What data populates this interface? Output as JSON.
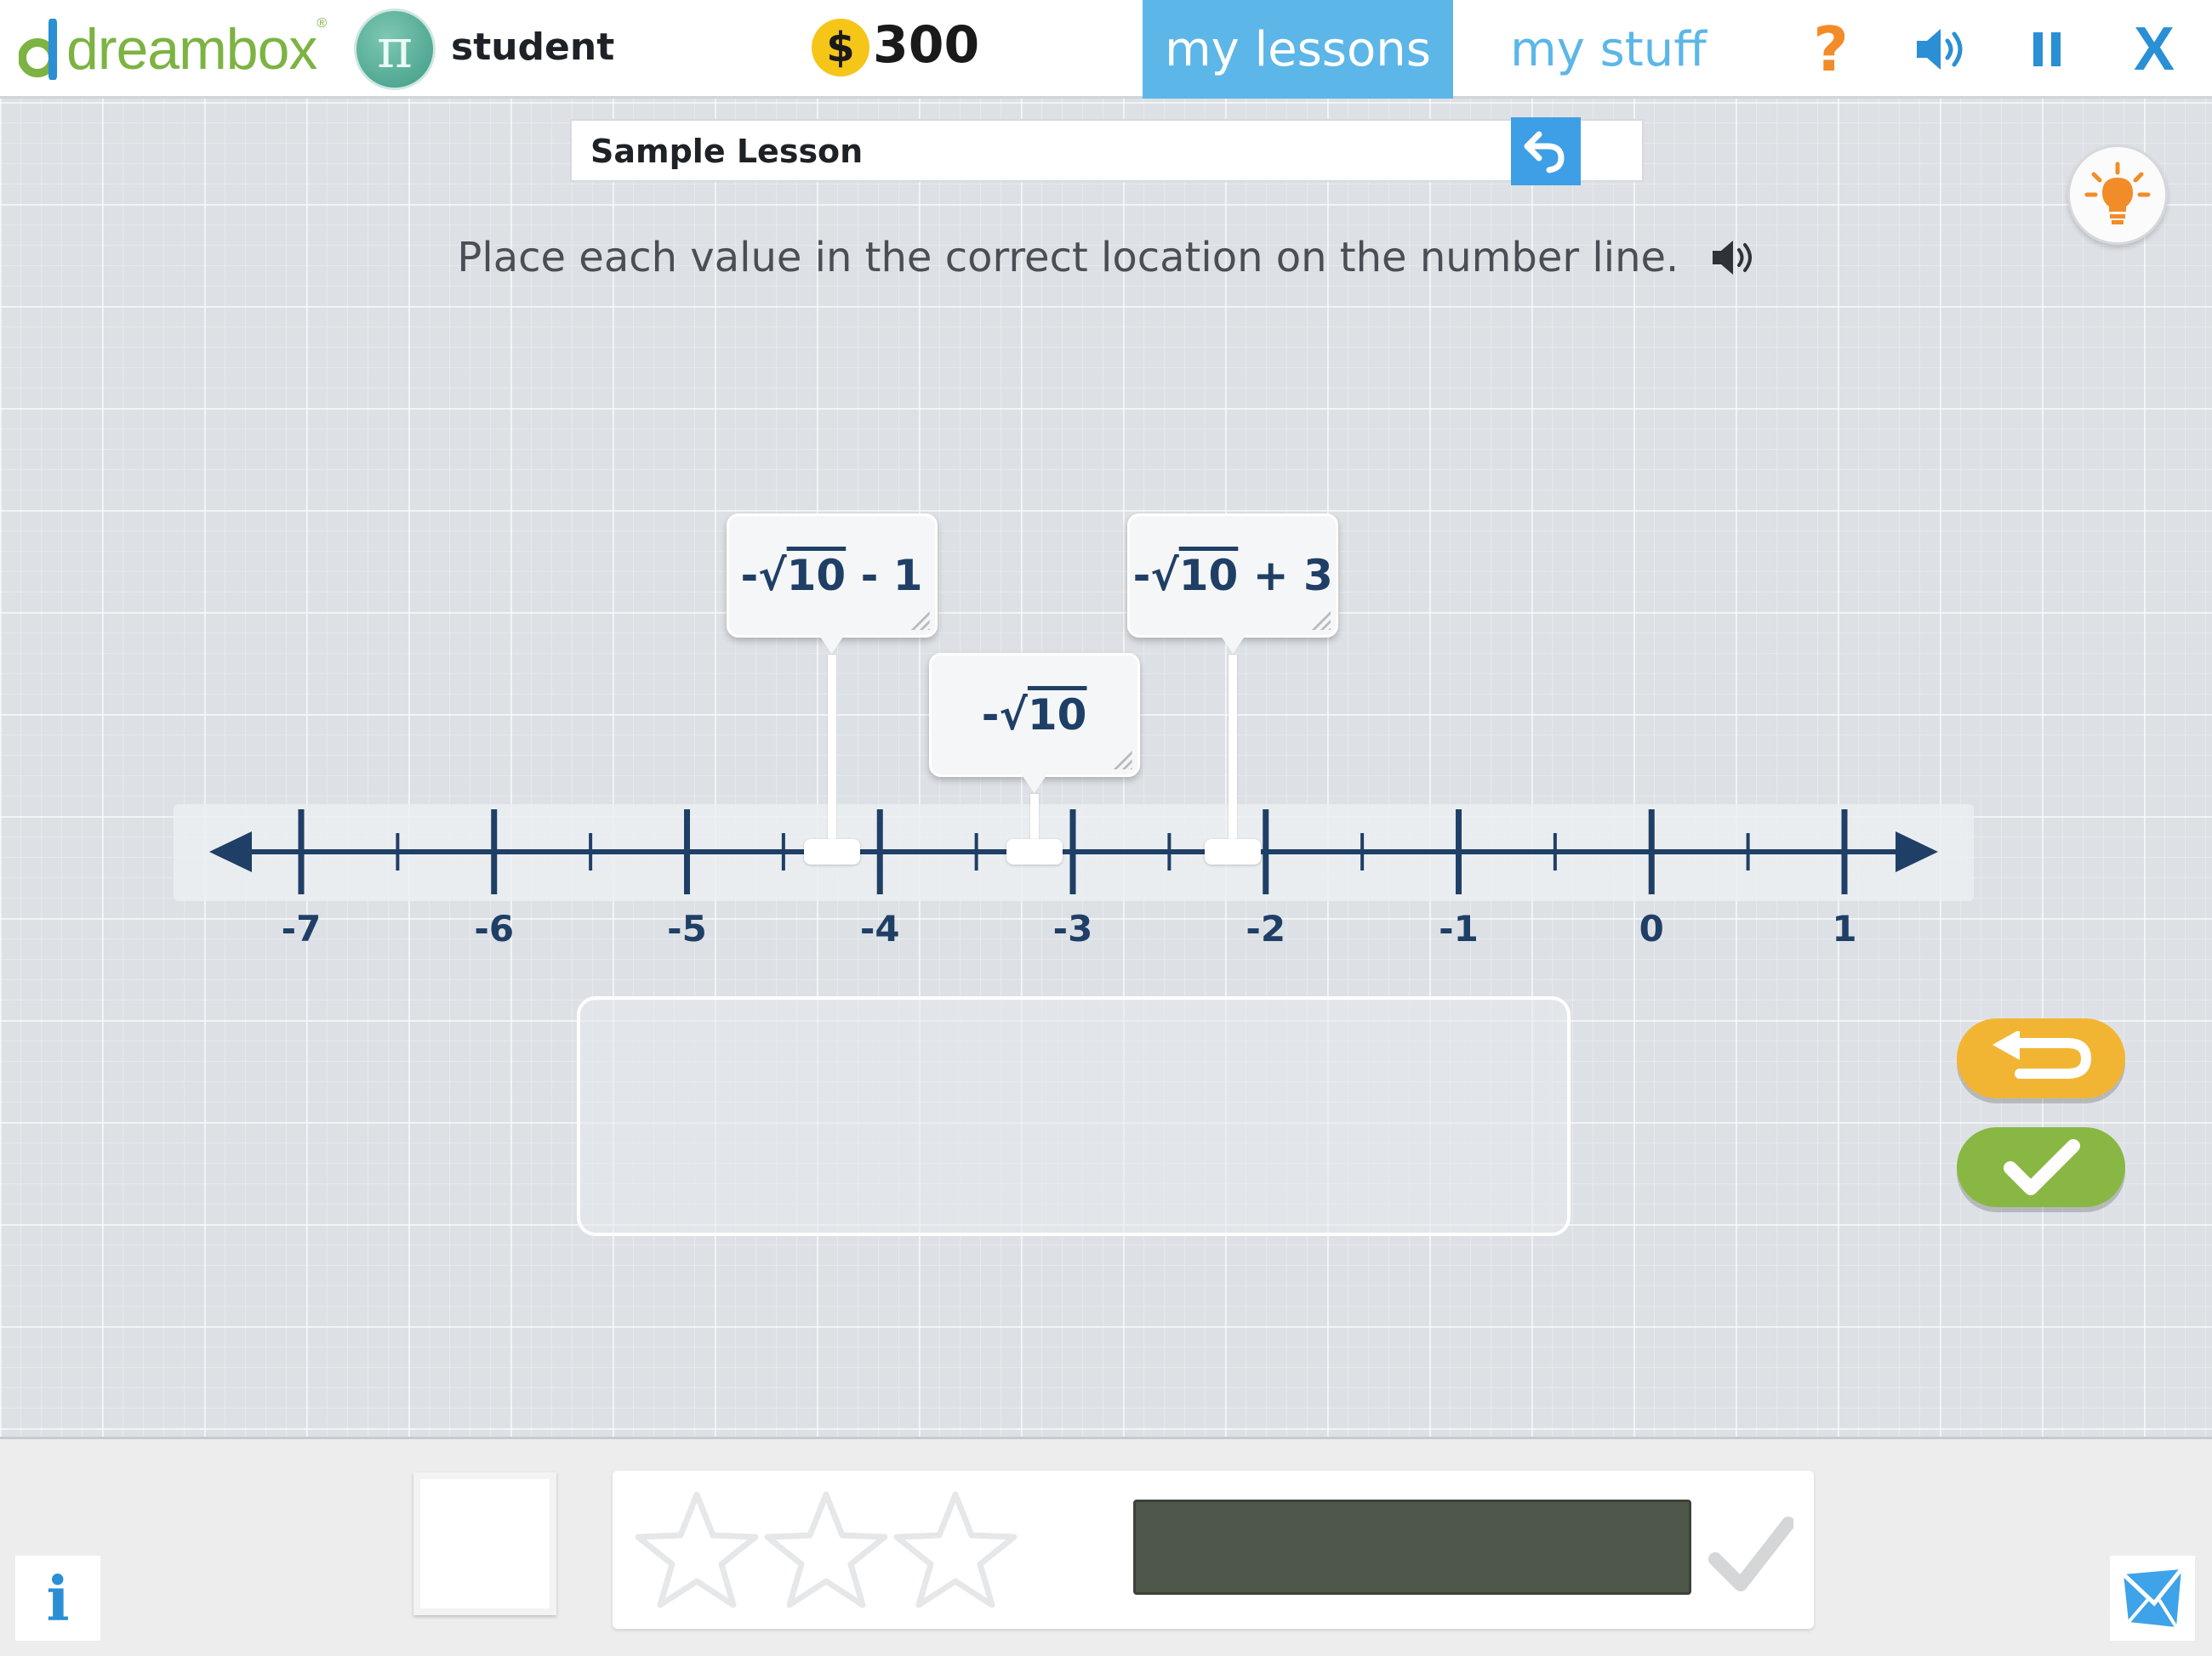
{
  "app": {
    "brand": "dreambox",
    "username": "student",
    "avatar_symbol": "π",
    "coin_symbol": "$",
    "coins": "300"
  },
  "nav": {
    "tabs": [
      {
        "label": "my lessons",
        "active": true
      },
      {
        "label": "my stuff",
        "active": false
      }
    ],
    "help_symbol": "?",
    "close_symbol": "X"
  },
  "lesson": {
    "title": "Sample Lesson",
    "instruction": "Place each value in the correct location on the number line."
  },
  "number_line": {
    "min": -7,
    "max": 1,
    "step": 0.5,
    "labels": [
      "-7",
      "-6",
      "-5",
      "-4",
      "-3",
      "-2",
      "-1",
      "0",
      "1"
    ]
  },
  "cards": [
    {
      "prefix": "-√",
      "radicand": "10",
      "suffix": " - 1",
      "placed_value": -4.25
    },
    {
      "prefix": "-√",
      "radicand": "10",
      "suffix": "",
      "placed_value": -3.2
    },
    {
      "prefix": "-√",
      "radicand": "10",
      "suffix": " + 3",
      "placed_value": -2.17
    }
  ],
  "progress": {
    "stars_total": 3,
    "stars_earned": 0,
    "fill_fraction": 0
  },
  "bottom": {
    "info_symbol": "i"
  },
  "colors": {
    "accent_blue": "#5cb6e8",
    "line_navy": "#1f3f66",
    "reset_yellow": "#f2b533",
    "check_green": "#88b843",
    "brand_green": "#7cb342",
    "help_orange": "#f28c28"
  }
}
